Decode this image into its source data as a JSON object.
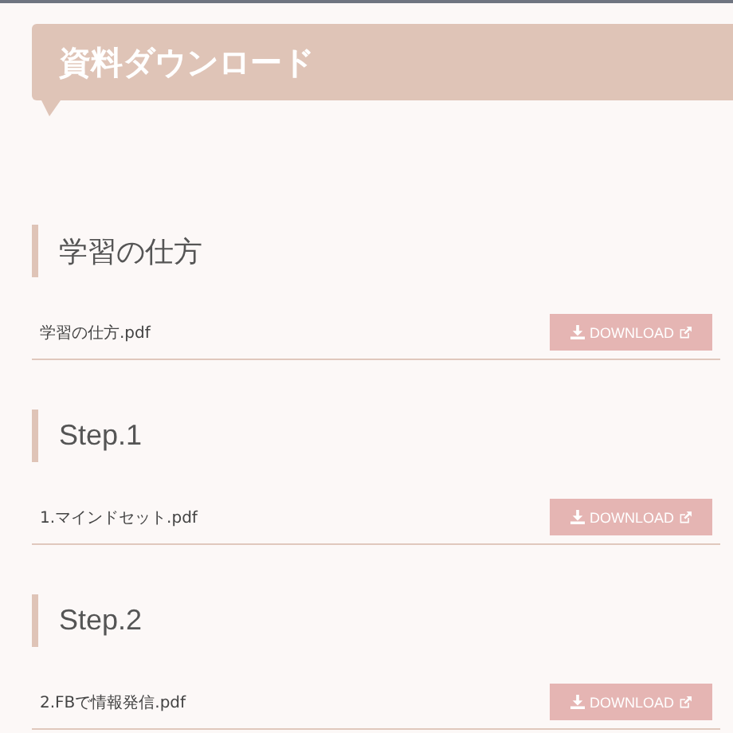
{
  "page_title": "資料ダウンロード",
  "sections": [
    {
      "heading": "学習の仕方",
      "file": "学習の仕方.pdf",
      "button": "DOWNLOAD"
    },
    {
      "heading": "Step.1",
      "file": "1.マインドセット.pdf",
      "button": "DOWNLOAD"
    },
    {
      "heading": "Step.2",
      "file": "2.FBで情報発信.pdf",
      "button": "DOWNLOAD"
    }
  ]
}
